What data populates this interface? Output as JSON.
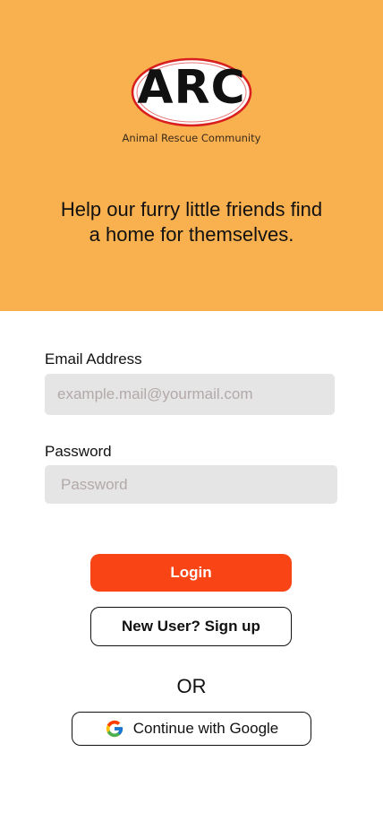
{
  "brand": {
    "logo_text": "ARC",
    "logo_subtitle": "Animal Rescue Community",
    "logo_ring_color": "#d91e1e",
    "hero_background": "#f9b04f"
  },
  "hero": {
    "tagline": "Help our furry little friends find a home for themselves."
  },
  "form": {
    "email_label": "Email Address",
    "email_placeholder": "example.mail@yourmail.com",
    "email_value": "",
    "password_label": "Password",
    "password_placeholder": "Password",
    "password_value": ""
  },
  "actions": {
    "login_label": "Login",
    "signup_label": "New User? Sign up",
    "divider_text": "OR",
    "google_label": "Continue with Google",
    "google_icon": "google-g-icon"
  },
  "colors": {
    "primary": "#f94516",
    "input_bg": "#e5e5e5"
  }
}
